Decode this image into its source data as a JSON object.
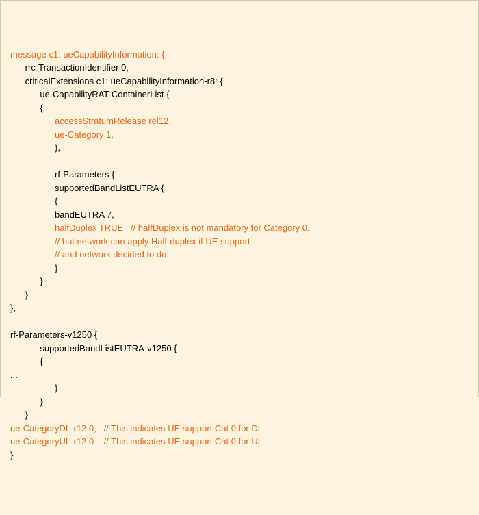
{
  "lines": [
    {
      "indent": 0,
      "segments": [
        {
          "t": "message c1: ueCapabilityInformation: {",
          "hl": true
        }
      ]
    },
    {
      "indent": 1,
      "segments": [
        {
          "t": "rrc-TransactionIdentifier 0,",
          "hl": false
        }
      ]
    },
    {
      "indent": 1,
      "segments": [
        {
          "t": "criticalExtensions c1: ueCapabilityInformation-r8: {",
          "hl": false
        }
      ]
    },
    {
      "indent": 2,
      "segments": [
        {
          "t": "ue-CapabilityRAT-ContainerList {",
          "hl": false
        }
      ]
    },
    {
      "indent": 2,
      "segments": [
        {
          "t": "{",
          "hl": false
        }
      ]
    },
    {
      "indent": 3,
      "segments": [
        {
          "t": "accessStratumRelease rel12,",
          "hl": true
        }
      ]
    },
    {
      "indent": 3,
      "segments": [
        {
          "t": "ue-Category 1,",
          "hl": true
        }
      ]
    },
    {
      "indent": 3,
      "segments": [
        {
          "t": "},",
          "hl": false
        }
      ]
    },
    {
      "indent": 0,
      "segments": [
        {
          "t": " ",
          "hl": false
        }
      ]
    },
    {
      "indent": 3,
      "segments": [
        {
          "t": "rf-Parameters {",
          "hl": false
        }
      ]
    },
    {
      "indent": 3,
      "segments": [
        {
          "t": "supportedBandListEUTRA {",
          "hl": false
        }
      ]
    },
    {
      "indent": 3,
      "segments": [
        {
          "t": "{",
          "hl": false
        }
      ]
    },
    {
      "indent": 3,
      "segments": [
        {
          "t": "bandEUTRA 7,",
          "hl": false
        }
      ]
    },
    {
      "indent": 3,
      "segments": [
        {
          "t": "halfDuplex TRUE   // halfDuplex is not mandatory for Category 0.",
          "hl": true
        }
      ]
    },
    {
      "indent": 3,
      "segments": [
        {
          "t": "// but network can apply Half-duplex if UE support",
          "hl": true
        }
      ]
    },
    {
      "indent": 3,
      "segments": [
        {
          "t": "// and network decided to do",
          "hl": true
        }
      ]
    },
    {
      "indent": 3,
      "segments": [
        {
          "t": "}",
          "hl": false
        }
      ]
    },
    {
      "indent": 2,
      "segments": [
        {
          "t": "}",
          "hl": false
        }
      ]
    },
    {
      "indent": 1,
      "segments": [
        {
          "t": "}",
          "hl": false
        }
      ]
    },
    {
      "indent": 0,
      "segments": [
        {
          "t": "},",
          "hl": false
        }
      ]
    },
    {
      "indent": 0,
      "segments": [
        {
          "t": " ",
          "hl": false
        }
      ]
    },
    {
      "indent": 0,
      "segments": [
        {
          "t": "rf-Parameters-v1250 {",
          "hl": false
        }
      ]
    },
    {
      "indent": 2,
      "segments": [
        {
          "t": "supportedBandListEUTRA-v1250 {",
          "hl": false
        }
      ]
    },
    {
      "indent": 2,
      "segments": [
        {
          "t": "{",
          "hl": false
        }
      ]
    },
    {
      "indent": 0,
      "segments": [
        {
          "t": "...",
          "hl": false
        }
      ]
    },
    {
      "indent": 3,
      "segments": [
        {
          "t": "}",
          "hl": false
        }
      ]
    },
    {
      "indent": 2,
      "segments": [
        {
          "t": "}",
          "hl": false
        }
      ]
    },
    {
      "indent": 1,
      "segments": [
        {
          "t": "}",
          "hl": false
        }
      ]
    },
    {
      "indent": 0,
      "segments": [
        {
          "t": "ue-CategoryDL-r12 0,   // This indicates UE support Cat 0 for DL",
          "hl": true
        }
      ]
    },
    {
      "indent": 0,
      "segments": [
        {
          "t": "ue-CategoryUL-r12 0    // This indicates UE support Cat 0 for UL",
          "hl": true
        }
      ]
    },
    {
      "indent": 0,
      "segments": [
        {
          "t": "}",
          "hl": false
        }
      ]
    }
  ],
  "indentUnit": "      "
}
